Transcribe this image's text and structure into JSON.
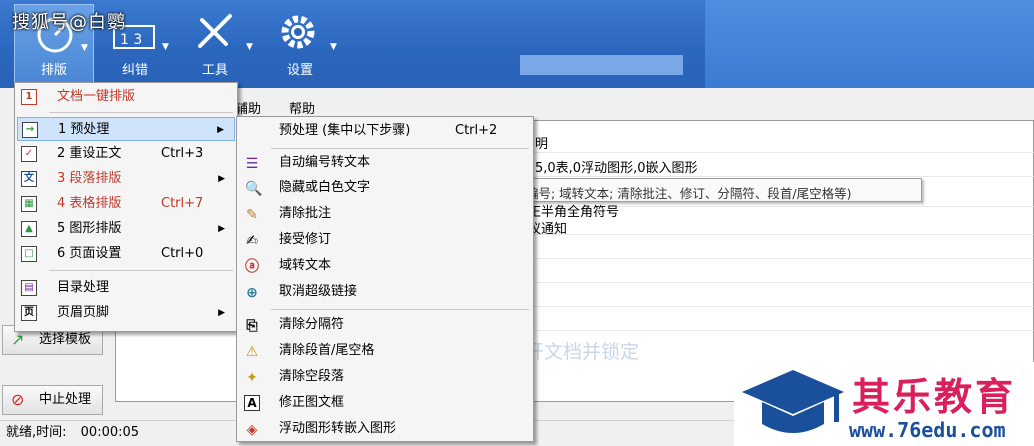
{
  "watermark": "搜狐号@白鹦",
  "toolbar": {
    "layout_label": "排版",
    "proofread_label": "纠错",
    "tools_label": "工具",
    "settings_label": "设置"
  },
  "menubar": {
    "help_partial": "辅助",
    "help": "帮助"
  },
  "document": {
    "line1": "明",
    "line2": "5,0表,0浮动图形,0嵌入图形",
    "line3": "正半角全角符号",
    "line4": "议通知",
    "ghost_text": "开文档并锁定",
    "tooltip": "编号; 域转文本; 清除批注、修订、分隔符、段首/尾空格等)"
  },
  "side_buttons": {
    "select_template": "选择模板",
    "stop_processing": "中止处理"
  },
  "status": {
    "state": "就绪,时间:",
    "time": "00:00:05"
  },
  "main_menu": {
    "items": [
      {
        "icon": "1",
        "label": "文档一键排版",
        "shortcut": ""
      },
      {
        "icon": "→",
        "label": "1 预处理",
        "shortcut": ""
      },
      {
        "icon": "✓",
        "label": "2 重设正文",
        "shortcut": "Ctrl+3"
      },
      {
        "icon": "文",
        "label": "3 段落排版",
        "shortcut": ""
      },
      {
        "icon": "▦",
        "label": "4 表格排版",
        "shortcut": "Ctrl+7"
      },
      {
        "icon": "▲",
        "label": "5 图形排版",
        "shortcut": ""
      },
      {
        "icon": "□",
        "label": "6 页面设置",
        "shortcut": "Ctrl+0"
      },
      {
        "icon": "▤",
        "label": "目录处理",
        "shortcut": ""
      },
      {
        "icon": "页",
        "label": "页眉页脚",
        "shortcut": ""
      }
    ]
  },
  "sub_menu": {
    "items": [
      {
        "icon": "",
        "label": "预处理 (集中以下步骤)",
        "shortcut": "Ctrl+2"
      },
      {
        "icon": "☰",
        "label": "自动编号转文本"
      },
      {
        "icon": "🔍",
        "label": "隐藏或白色文字"
      },
      {
        "icon": "✎",
        "label": "清除批注"
      },
      {
        "icon": "✍",
        "label": "接受修订"
      },
      {
        "icon": "ⓐ",
        "label": "域转文本"
      },
      {
        "icon": "⊕",
        "label": "取消超级链接"
      },
      {
        "icon": "⎘",
        "label": "清除分隔符"
      },
      {
        "icon": "⚠",
        "label": "清除段首/尾空格"
      },
      {
        "icon": "✦",
        "label": "清除空段落"
      },
      {
        "icon": "A",
        "label": "修正图文框"
      },
      {
        "icon": "◈",
        "label": "浮动图形转嵌入图形"
      }
    ]
  },
  "logo": {
    "name": "其乐教育",
    "url": "www.76edu.com"
  },
  "colors": {
    "ribbon": "#2b66bd",
    "menu_highlight": "#cfe4fb",
    "red_item": "#c0392b",
    "logo_pink": "#d9205d",
    "logo_blue": "#1a4f9c"
  }
}
